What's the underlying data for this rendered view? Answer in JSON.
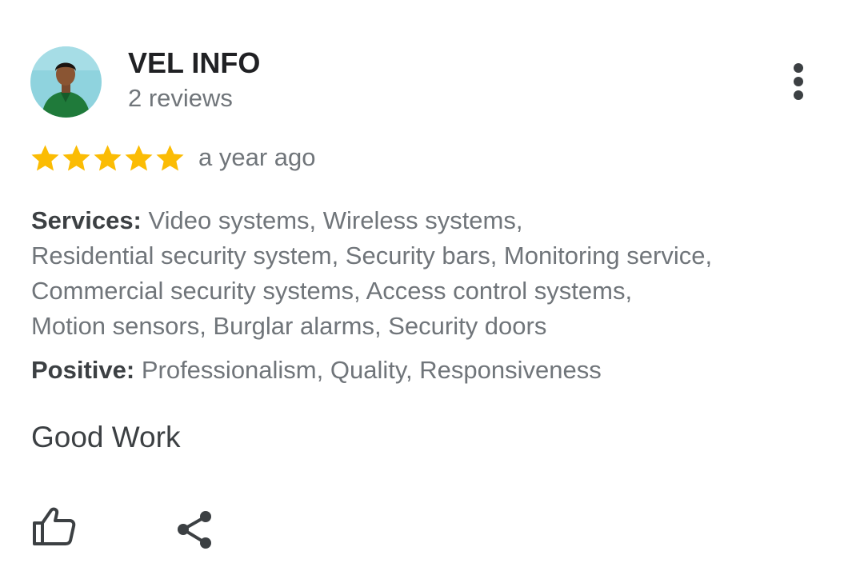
{
  "review": {
    "author_name": "VEL INFO",
    "review_count": "2 reviews",
    "rating": 5,
    "rating_max": 5,
    "time_ago": "a year ago",
    "services_label": "Services:",
    "services_lines": [
      " Video systems, Wireless systems,",
      "Residential security system, Security bars, Monitoring service,",
      "Commercial security systems, Access control systems,",
      "Motion sensors, Burglar alarms, Security doors"
    ],
    "positive_label": "Positive:",
    "positive_value": " Professionalism, Quality, Responsiveness",
    "text": "Good Work"
  },
  "icons": {
    "more": "more-vertical-icon",
    "star": "star-icon",
    "like": "thumbs-up-icon",
    "share": "share-icon"
  },
  "colors": {
    "star": "#fbbc04",
    "name": "#202124",
    "secondary_text": "#70757a",
    "icon": "#3c4043"
  }
}
